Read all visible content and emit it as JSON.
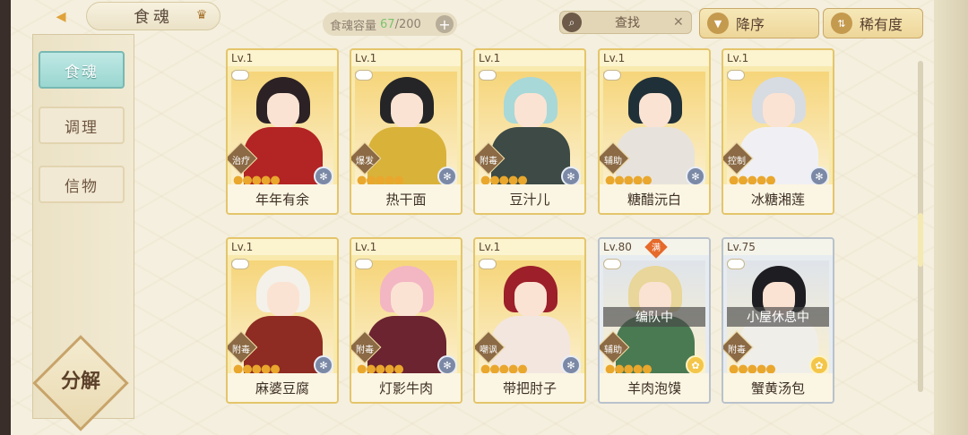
{
  "header": {
    "title": "食魂",
    "capacity_label": "食魂容量",
    "capacity_current": "67",
    "capacity_max": "/200",
    "capacity_plus": "+",
    "search_label": "查找",
    "search_clear": "✕",
    "sort_order_label": "降序",
    "sort_rarity_label": "稀有度"
  },
  "sidebar": {
    "items": [
      {
        "label": "食魂",
        "active": true
      },
      {
        "label": "调理",
        "active": false
      },
      {
        "label": "信物",
        "active": false
      }
    ],
    "decompose_label": "分解"
  },
  "cards": [
    {
      "lv": "Lv.1",
      "name": "年年有余",
      "role": "治疗",
      "style": "gold",
      "hair": "#2c2225",
      "outfit": "#b32424",
      "emblem": "blue"
    },
    {
      "lv": "Lv.1",
      "name": "热干面",
      "role": "爆发",
      "style": "gold",
      "hair": "#252527",
      "outfit": "#d9b23a",
      "emblem": "blue"
    },
    {
      "lv": "Lv.1",
      "name": "豆汁儿",
      "role": "附毒",
      "style": "gold",
      "hair": "#a8d8d8",
      "outfit": "#3d4a45",
      "emblem": "blue"
    },
    {
      "lv": "Lv.1",
      "name": "糖醋沅白",
      "role": "辅助",
      "style": "gold",
      "hair": "#203038",
      "outfit": "#e7e3dc",
      "emblem": "blue"
    },
    {
      "lv": "Lv.1",
      "name": "冰糖湘莲",
      "role": "控制",
      "style": "gold",
      "hair": "#d7dbe2",
      "outfit": "#f0f0f4",
      "emblem": "blue"
    },
    {
      "lv": "Lv.1",
      "name": "麻婆豆腐",
      "role": "附毒",
      "style": "gold",
      "hair": "#f4f1ea",
      "outfit": "#8e2b22",
      "emblem": "blue"
    },
    {
      "lv": "Lv.1",
      "name": "灯影牛肉",
      "role": "附毒",
      "style": "gold",
      "hair": "#f3b6c3",
      "outfit": "#6b2430",
      "emblem": "blue"
    },
    {
      "lv": "Lv.1",
      "name": "带把肘子",
      "role": "嘲讽",
      "style": "gold",
      "hair": "#9c1f2a",
      "outfit": "#f3e6df",
      "emblem": "blue"
    },
    {
      "lv": "Lv.80",
      "name": "羊肉泡馍",
      "role": "辅助",
      "style": "blue",
      "hair": "#e8d69a",
      "outfit": "#4a7a52",
      "emblem": "gold",
      "status": "编队中",
      "full": "满"
    },
    {
      "lv": "Lv.75",
      "name": "蟹黄汤包",
      "role": "附毒",
      "style": "blue",
      "hair": "#1e1d22",
      "outfit": "#f0eee8",
      "emblem": "gold",
      "status": "小屋休息中"
    }
  ],
  "stars": "●●●●●",
  "colors": {
    "accent_gold": "#e4c56b",
    "active_tab": "#9ad6d0",
    "capacity_green": "#7bc46c"
  }
}
